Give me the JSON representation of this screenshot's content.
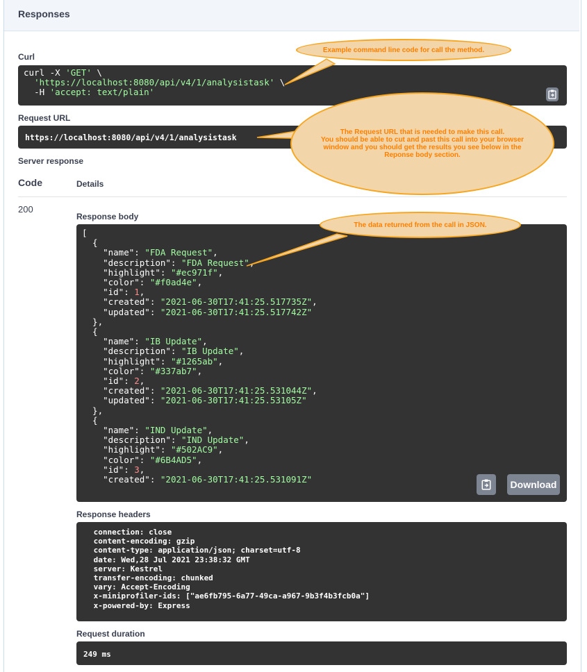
{
  "responses_title": "Responses",
  "curl": {
    "label": "Curl",
    "line1_cmd": "curl -X ",
    "line1_method": "'GET'",
    "line1_end": " \\",
    "line2_url": "'https://localhost:8080/api/v4/1/analysistask'",
    "line2_end": " \\",
    "line3_flag": "-H ",
    "line3_header": "'accept: text/plain'"
  },
  "request_url": {
    "label": "Request URL",
    "value": "https://localhost:8080/api/v4/1/analysistask"
  },
  "server_response": {
    "label": "Server response",
    "code_header": "Code",
    "details_header": "Details",
    "code": "200"
  },
  "response_body": {
    "label": "Response body",
    "download_label": "Download",
    "items": [
      {
        "name": "FDA Request",
        "description": "FDA Request",
        "highlight": "#ec971f",
        "color": "#f0ad4e",
        "id": "1",
        "created": "2021-06-30T17:41:25.517735Z",
        "updated": "2021-06-30T17:41:25.517742Z"
      },
      {
        "name": "IB Update",
        "description": "IB Update",
        "highlight": "#1265ab",
        "color": "#337ab7",
        "id": "2",
        "created": "2021-06-30T17:41:25.531044Z",
        "updated": "2021-06-30T17:41:25.53105Z"
      },
      {
        "name": "IND Update",
        "description": "IND Update",
        "highlight": "#502AC9",
        "color": "#6B4AD5",
        "id": "3",
        "created": "2021-06-30T17:41:25.531091Z"
      }
    ]
  },
  "response_headers": {
    "label": "Response headers",
    "text": " connection: close \n content-encoding: gzip \n content-type: application/json; charset=utf-8 \n date: Wed,28 Jul 2021 23:38:32 GMT \n server: Kestrel \n transfer-encoding: chunked \n vary: Accept-Encoding \n x-miniprofiler-ids: [\"ae6fb795-6a77-49ca-a967-9b3f4b3fcb0a\"] \n x-powered-by: Express "
  },
  "request_duration": {
    "label": "Request duration",
    "value": "249 ms"
  },
  "callouts": {
    "curl_note": "Example command line code for call the method.",
    "url_note": "The Request URL that is needed to make this call.\nYou should be able to cut and past this call into your browser window and you should get the results you see below in the Reponse body section.",
    "json_note": "The data returned from the call in JSON."
  },
  "colors": {
    "code_bg": "#333333",
    "string": "#a2fca2",
    "number": "#fc8c8c",
    "callout_fill": "#f2d5a8",
    "callout_border": "#f5a623",
    "callout_text": "#ff8000"
  }
}
